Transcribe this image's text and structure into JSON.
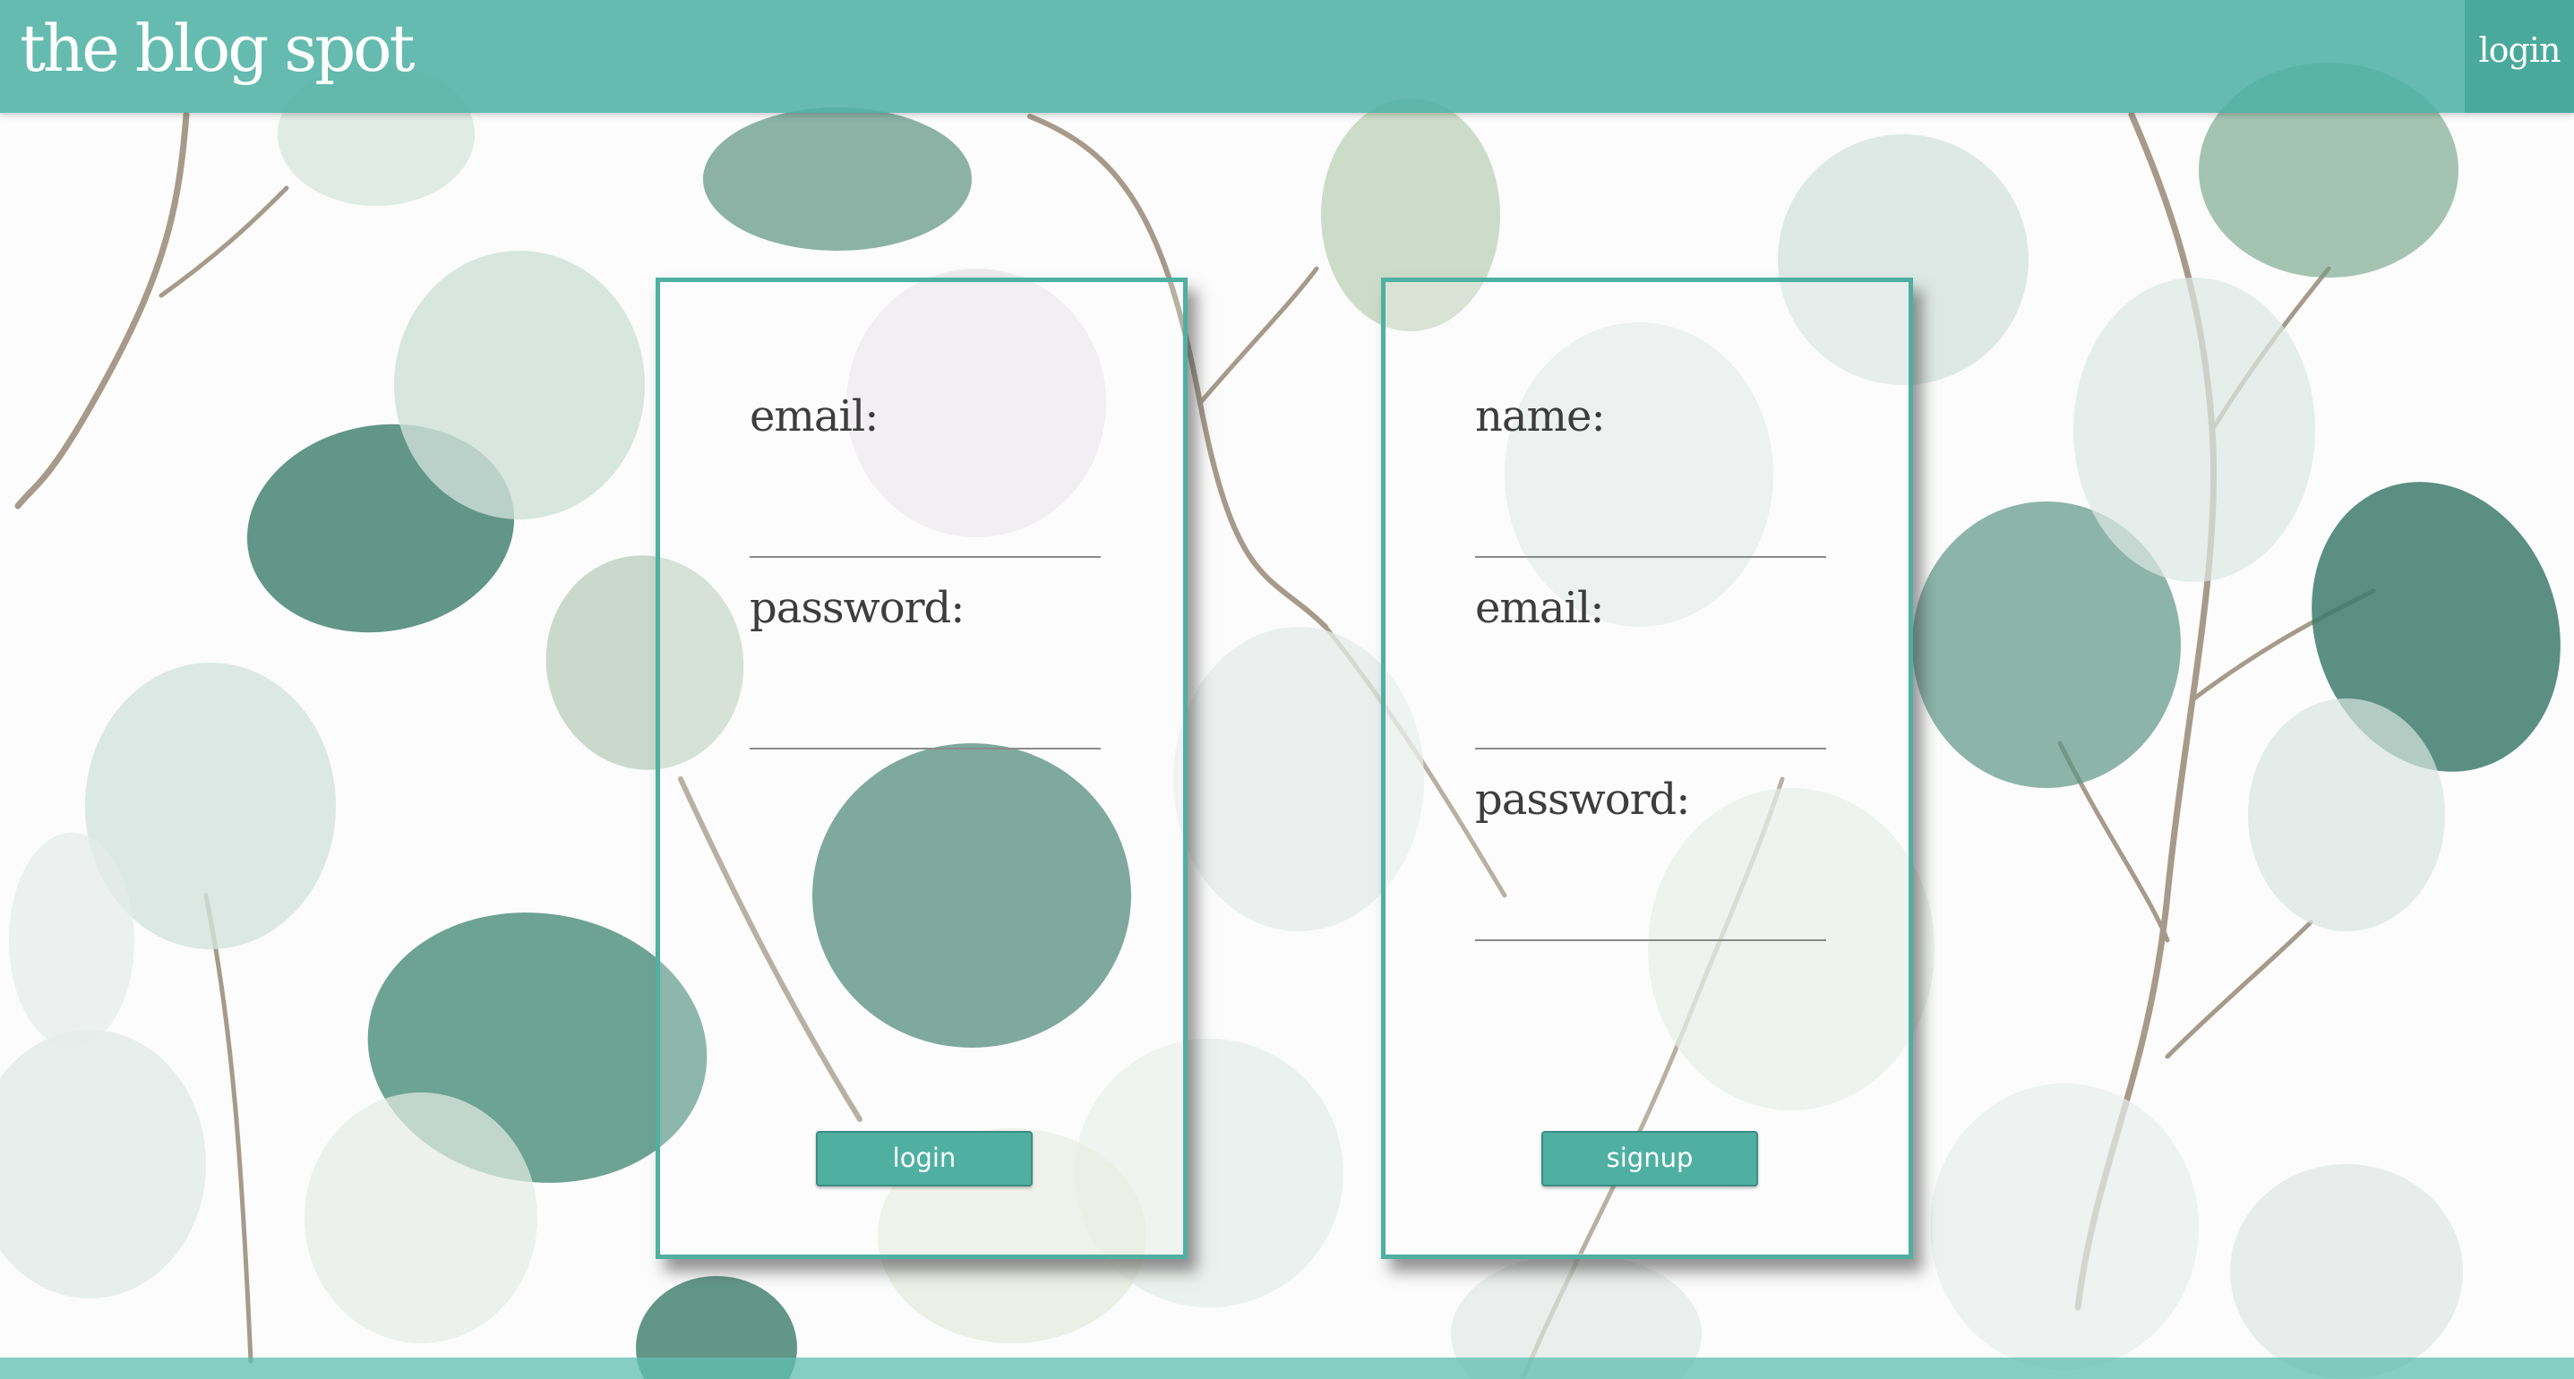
{
  "header": {
    "brand": "the blog spot",
    "nav_login": "login"
  },
  "login_form": {
    "email_label": "email:",
    "email_value": "",
    "password_label": "password:",
    "password_value": "",
    "submit_label": "login"
  },
  "signup_form": {
    "name_label": "name:",
    "name_value": "",
    "email_label": "email:",
    "email_value": "",
    "password_label": "password:",
    "password_value": "",
    "submit_label": "signup"
  },
  "theme": {
    "accent": "#4fb0a2",
    "header_bg": "#50b2a4",
    "leaf_dark": "#3f7f6c",
    "leaf_light": "#cfe0da",
    "stem": "#8a7a66"
  }
}
